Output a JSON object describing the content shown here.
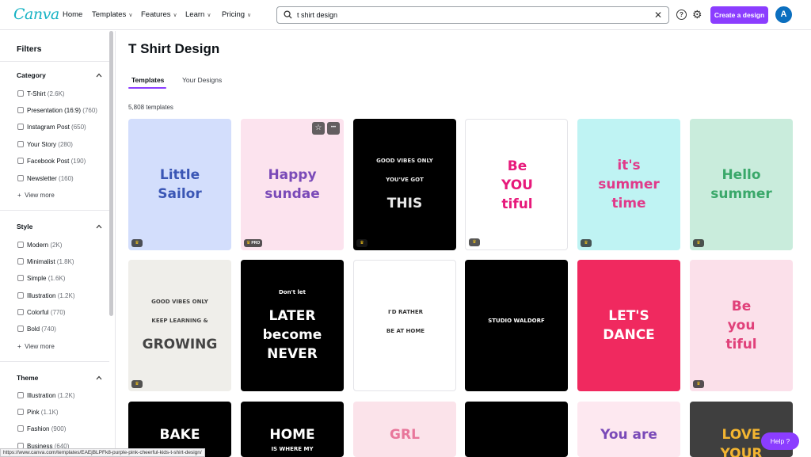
{
  "header": {
    "logo": "Canva",
    "nav": [
      {
        "label": "Home",
        "chevron": false
      },
      {
        "label": "Templates",
        "chevron": true
      },
      {
        "label": "Features",
        "chevron": true
      },
      {
        "label": "Learn",
        "chevron": true
      },
      {
        "label": "Pricing",
        "chevron": true
      }
    ],
    "search_value": "t shirt design",
    "help_glyph": "?",
    "create_label": "Create a design",
    "avatar_initial": "A",
    "accent": "#8b3dff"
  },
  "sidebar": {
    "title": "Filters",
    "sections": [
      {
        "title": "Category",
        "options": [
          {
            "label": "T-Shirt",
            "count": "(2.6K)"
          },
          {
            "label": "Presentation (16:9)",
            "count": "(760)"
          },
          {
            "label": "Instagram Post",
            "count": "(650)"
          },
          {
            "label": "Your Story",
            "count": "(280)"
          },
          {
            "label": "Facebook Post",
            "count": "(190)"
          },
          {
            "label": "Newsletter",
            "count": "(160)"
          }
        ],
        "view_more": "View more"
      },
      {
        "title": "Style",
        "options": [
          {
            "label": "Modern",
            "count": "(2K)"
          },
          {
            "label": "Minimalist",
            "count": "(1.8K)"
          },
          {
            "label": "Simple",
            "count": "(1.6K)"
          },
          {
            "label": "Illustration",
            "count": "(1.2K)"
          },
          {
            "label": "Colorful",
            "count": "(770)"
          },
          {
            "label": "Bold",
            "count": "(740)"
          }
        ],
        "view_more": "View more"
      },
      {
        "title": "Theme",
        "options": [
          {
            "label": "Illustration",
            "count": "(1.2K)"
          },
          {
            "label": "Pink",
            "count": "(1.1K)"
          },
          {
            "label": "Fashion",
            "count": "(900)"
          },
          {
            "label": "Business",
            "count": "(640)"
          }
        ]
      }
    ]
  },
  "main": {
    "title": "T Shirt Design",
    "tabs": [
      "Templates",
      "Your Designs"
    ],
    "count": "5,808 templates",
    "pro_badge": "PRO",
    "cards": [
      {
        "bg": "#d3defc",
        "text": [
          "Little",
          "Sailor"
        ],
        "color": "#3a56b5"
      },
      {
        "bg": "#fce3ee",
        "text": [
          "Happy",
          "sundae"
        ],
        "color": "#7a4ab8"
      },
      {
        "bg": "#000000",
        "text": [
          "GOOD VIBES ONLY",
          "YOU'VE GOT",
          "THIS"
        ],
        "color": "#e8e8e8"
      },
      {
        "bg": "#ffffff",
        "text": [
          "Be",
          "YOU",
          "tiful"
        ],
        "color": "#e7197b"
      },
      {
        "bg": "#bff3f3",
        "text": [
          "it's",
          "summer",
          "time"
        ],
        "color": "#e03a8a"
      },
      {
        "bg": "#c9ecdc",
        "text": [
          "Hello",
          "summer"
        ],
        "color": "#3aa86a"
      },
      {
        "bg": "#efeeea",
        "text": [
          "GOOD VIBES ONLY",
          "KEEP LEARNING &",
          "GROWING"
        ],
        "color": "#444444"
      },
      {
        "bg": "#000000",
        "text": [
          "Don't let",
          "LATER",
          "become",
          "NEVER"
        ],
        "color": "#ffffff"
      },
      {
        "bg": "#ffffff",
        "text": [
          "I'D RATHER",
          "BE AT HOME"
        ],
        "color": "#333333"
      },
      {
        "bg": "#000000",
        "text": [
          "STUDIO WALDORF"
        ],
        "color": "#ffffff"
      },
      {
        "bg": "#f0295f",
        "text": [
          "LET'S",
          "DANCE"
        ],
        "color": "#ffffff"
      },
      {
        "bg": "#fbe0ea",
        "text": [
          "Be",
          "you",
          "tiful"
        ],
        "color": "#e0417a"
      },
      {
        "bg": "#000000",
        "text": [
          "BAKE"
        ],
        "color": "#ffffff"
      },
      {
        "bg": "#000000",
        "text": [
          "HOME",
          "IS WHERE MY"
        ],
        "color": "#ffffff"
      },
      {
        "bg": "#fbe3ea",
        "text": [
          "GRL"
        ],
        "color": "#e8779b"
      },
      {
        "bg": "#000000",
        "text": [],
        "color": "#ffffff"
      },
      {
        "bg": "#fde8f0",
        "text": [
          "You are"
        ],
        "color": "#7a4ab8"
      },
      {
        "bg": "#3f3f3f",
        "text": [
          "LOVE",
          "YOUR"
        ],
        "color": "#f3b531"
      }
    ]
  },
  "status_url": "https://www.canva.com/templates/EAEjBLPFk8-purple-pink-cheerful-kids-t-shirt-design/",
  "help_label": "Help ?"
}
